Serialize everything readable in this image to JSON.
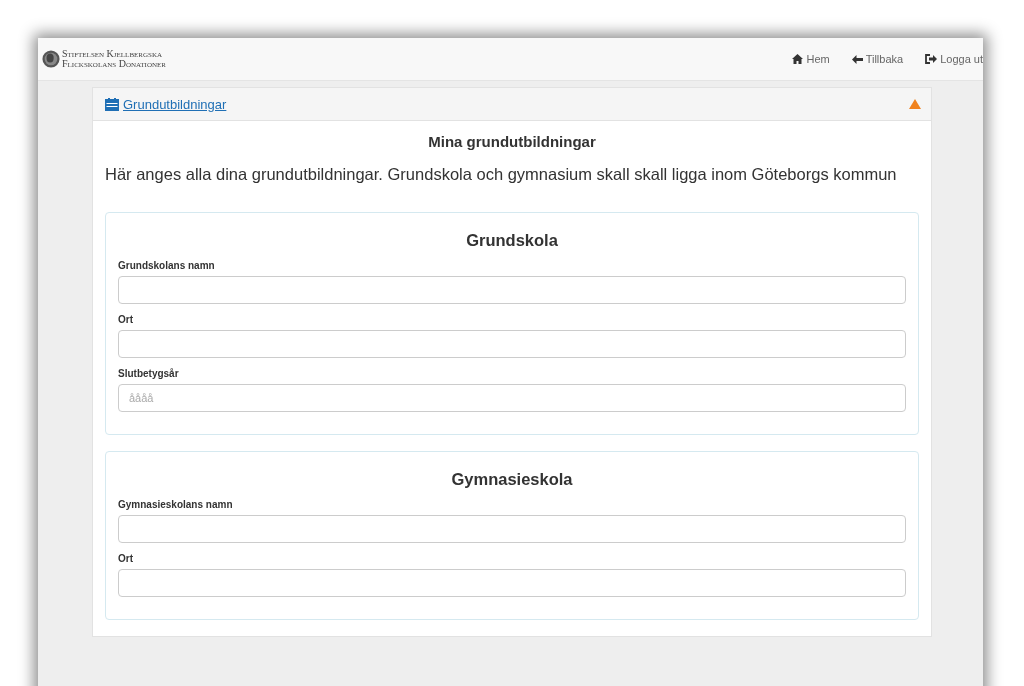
{
  "brand": {
    "lines": [
      "Stiftelsen Kjellbergska",
      "Flickskolans Donationer"
    ]
  },
  "nav": [
    {
      "kind": "home",
      "label": "Hem"
    },
    {
      "kind": "back",
      "label": "Tillbaka"
    },
    {
      "kind": "logout",
      "label": "Logga ut"
    }
  ],
  "panel": {
    "title": "Grundutbildningar",
    "expanded": true,
    "heading": "Mina grundutbildningar",
    "intro": "Här anges alla dina grundutbildningar. Grundskola och gymnasium skall skall ligga inom Göteborgs kommun",
    "sections": [
      {
        "title": "Grundskola",
        "fields": [
          {
            "label": "Grundskolans namn"
          },
          {
            "label": "Ort"
          },
          {
            "label": "Slutbetygsår",
            "placeholder": "åååå"
          }
        ]
      },
      {
        "title": "Gymnasieskola",
        "fields": [
          {
            "label": "Gymnasieskolans namn"
          },
          {
            "label": "Ort"
          }
        ]
      }
    ]
  }
}
